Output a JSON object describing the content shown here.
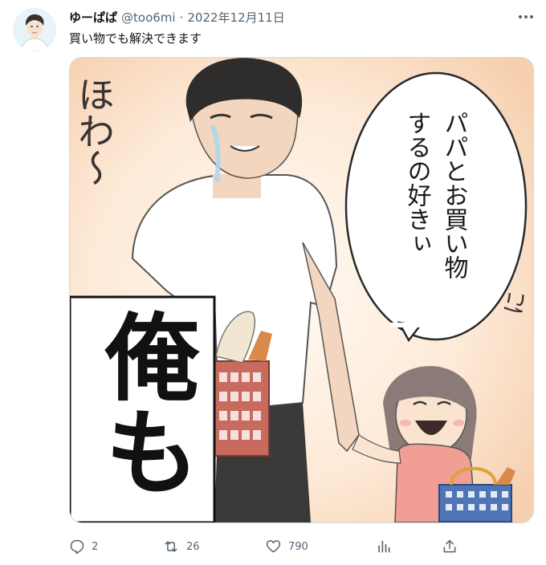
{
  "tweet": {
    "author_name": "ゆーぱぱ",
    "handle": "@too6mi",
    "separator": "·",
    "date": "2022年12月11日",
    "text": "買い物でも解決できます"
  },
  "image": {
    "speech_bubble": [
      "パパとお買い物",
      "するの好きぃ"
    ],
    "sfx_left": "ほわ〜",
    "sfx_right": "にっこぉ",
    "panel_text": "俺も"
  },
  "actions": {
    "replies": "2",
    "retweets": "26",
    "likes": "790"
  },
  "icons": [
    "more-icon",
    "reply-icon",
    "retweet-icon",
    "like-icon",
    "views-icon",
    "share-icon"
  ],
  "colors": {
    "text_primary": "#0f1419",
    "text_secondary": "#536471",
    "border": "#cfd9de"
  }
}
